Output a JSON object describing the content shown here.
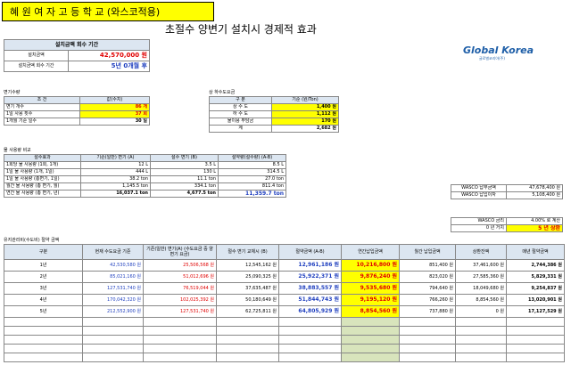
{
  "school_title": "혜 원 여 자 고 등 학 교 (와스코적용)",
  "main_title": "초절수 양변기 설치시 경제적 효과",
  "logo": {
    "text": "Global Korea",
    "sub": "글로벌코리아(주)"
  },
  "payback": {
    "header": "설치금액 회수 기간",
    "rows": [
      {
        "label": "설치금액",
        "value": "42,570,000 원"
      },
      {
        "label": "설치금액 회수 기간",
        "value": "5년 0개월 후"
      }
    ]
  },
  "toilet": {
    "title": "변기수량",
    "headers": [
      "조 건",
      "값(수치)"
    ],
    "rows": [
      {
        "label": "변기 개수",
        "value": "86 개"
      },
      {
        "label": "1일 사용 횟수",
        "value": "37 회"
      },
      {
        "label": "1개월 기준 일수",
        "value": "30 일"
      }
    ]
  },
  "water_fee": {
    "title": "상 하수도요금",
    "headers": [
      "구 분",
      "기준 (원/Ton)"
    ],
    "rows": [
      {
        "label": "상 수 도",
        "value": "1,400 원"
      },
      {
        "label": "하 수 도",
        "value": "1,112 원"
      },
      {
        "label": "물이용 부담금",
        "value": "170 원"
      },
      {
        "label": "계",
        "value": "2,682 원"
      }
    ]
  },
  "usage": {
    "title": "물 사용량 비교",
    "headers": [
      "절수효과",
      "기존(일반) 변기 (A)",
      "절수 변기 (B)",
      "절약량(절수량) (A-B)"
    ],
    "rows": [
      [
        "1회당 물 사용량 (1회, 1개)",
        "12 L",
        "3.5 L",
        "8.5 L"
      ],
      [
        "1일 물 사용량 (1개, 1일)",
        "444 L",
        "130 L",
        "314.5 L"
      ],
      [
        "1일 물 사용량 (총변기, 1일)",
        "38.2 ton",
        "11.1 ton",
        "27.0 ton"
      ],
      [
        "월간 물 사용량 (총 변기, 월)",
        "1,145.5 ton",
        "334.1 ton",
        "811.4 ton"
      ],
      [
        "연간 물 사용량 (총 변기, 년)",
        "16,037.1 ton",
        "4,677.5 ton",
        "11,359.7 ton"
      ]
    ]
  },
  "wasco": {
    "rows": [
      {
        "label": "WASCO 납부금액",
        "value": "47,678,400 원"
      },
      {
        "label": "WASCO 납입이자",
        "value": "5,108,400 원"
      }
    ],
    "rate": {
      "label": "WASCO 금리",
      "value": "4.00% 로 계산"
    },
    "term": {
      "label": "0 년 거치",
      "value": "5 년 상환"
    }
  },
  "savings": {
    "title": "유지관리비(수도비) 절약 금액",
    "headers": [
      "구분",
      "현재 수도요금 기준",
      "기존(일반) 변기(A) (수도요금 중 양변기 요금)",
      "절수 변기 교체시 (B)",
      "절약금액 (A-B)",
      "연간납입금액",
      "월간 납입금액",
      "상환잔액",
      "매년 절약금액"
    ],
    "rows": [
      [
        "1년",
        "42,530,580 원",
        "25,506,568 원",
        "12,545,162 원",
        "12,961,186 원",
        "10,216,800 원",
        "851,400 원",
        "37,461,600 원",
        "2,744,386 원"
      ],
      [
        "2년",
        "85,021,160 원",
        "51,012,696 원",
        "25,090,325 원",
        "25,922,371 원",
        "9,876,240 원",
        "823,020 원",
        "27,585,360 원",
        "5,829,331 원"
      ],
      [
        "3년",
        "127,531,740 원",
        "76,519,044 원",
        "37,635,487 원",
        "38,883,557 원",
        "9,535,680 원",
        "794,640 원",
        "18,049,680 원",
        "9,254,837 원"
      ],
      [
        "4년",
        "170,042,320 원",
        "102,025,392 원",
        "50,180,649 원",
        "51,844,743 원",
        "9,195,120 원",
        "766,260 원",
        "8,854,560 원",
        "13,020,901 원"
      ],
      [
        "5년",
        "212,552,900 원",
        "127,531,740 원",
        "62,725,811 원",
        "64,805,929 원",
        "8,854,560 원",
        "737,880 원",
        "0 원",
        "17,127,529 원"
      ]
    ],
    "blank_rows": 5
  },
  "colors": {
    "yellow": "#ffff00",
    "header": "#dce6f1",
    "green": "#d8e4bc",
    "red": "#e00000",
    "blue": "#1f3fbf"
  }
}
